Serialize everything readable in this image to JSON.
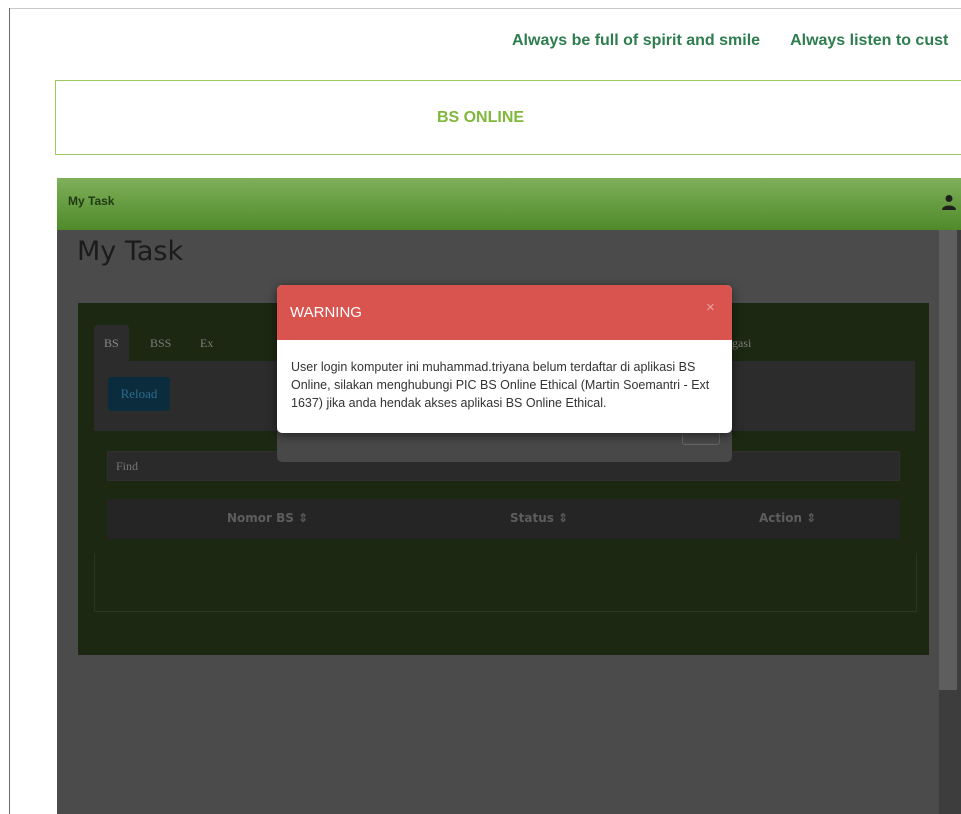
{
  "marquee": {
    "messages": [
      "Always be full of spirit and smile",
      "Always listen to cust"
    ]
  },
  "header": {
    "title": "BS ONLINE"
  },
  "app": {
    "navbar_title": "My Task",
    "page_title": "My Task",
    "tabs": [
      {
        "label": "BS",
        "active": true
      },
      {
        "label": "BSS",
        "active": false
      },
      {
        "label": "Ex BS",
        "active": false
      },
      {
        "label": "gasi",
        "active": false
      }
    ],
    "reload_label": "Reload",
    "find_placeholder": "Find",
    "table_headers": [
      "Nomor BS",
      "Status",
      "Action"
    ],
    "sort_icon": "sort-icon"
  },
  "modal": {
    "title": "WARNING",
    "close_label": "×",
    "message": "User login komputer ini muhammad.triyana belum terdaftar di aplikasi BS Online, silakan menghubungi PIC BS Online Ethical (Martin Soemantri - Ext 1637) jika anda hendak akses aplikasi BS Online Ethical."
  },
  "colors": {
    "header_accent": "#7fb83a",
    "marquee_text": "#2e7d4f",
    "modal_header": "#d9534f",
    "navbar": "#6aa045"
  }
}
